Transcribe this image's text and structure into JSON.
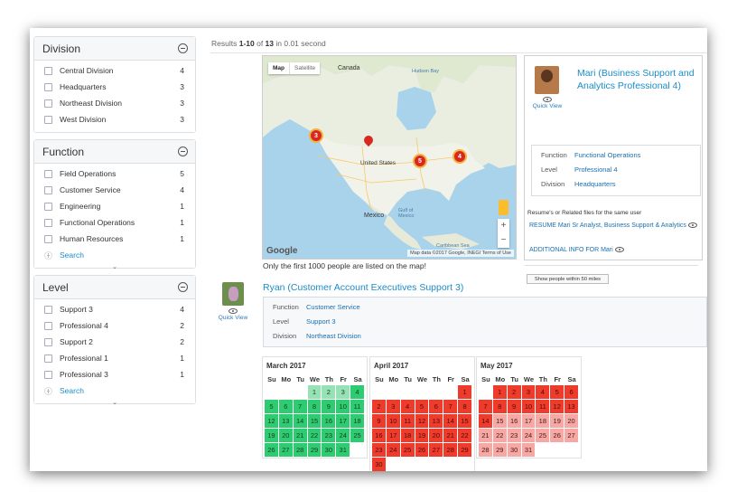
{
  "facets": {
    "division": {
      "title": "Division",
      "items": [
        {
          "label": "Central Division",
          "count": "4"
        },
        {
          "label": "Headquarters",
          "count": "3"
        },
        {
          "label": "Northeast Division",
          "count": "3"
        },
        {
          "label": "West Division",
          "count": "3"
        }
      ]
    },
    "function": {
      "title": "Function",
      "items": [
        {
          "label": "Field Operations",
          "count": "5"
        },
        {
          "label": "Customer Service",
          "count": "4"
        },
        {
          "label": "Engineering",
          "count": "1"
        },
        {
          "label": "Functional Operations",
          "count": "1"
        },
        {
          "label": "Human Resources",
          "count": "1"
        }
      ],
      "search_label": "Search"
    },
    "level": {
      "title": "Level",
      "items": [
        {
          "label": "Support 3",
          "count": "4"
        },
        {
          "label": "Professional 4",
          "count": "2"
        },
        {
          "label": "Support 2",
          "count": "2"
        },
        {
          "label": "Professional 1",
          "count": "1"
        },
        {
          "label": "Professional 3",
          "count": "1"
        }
      ],
      "search_label": "Search"
    }
  },
  "results": {
    "prefix": "Results ",
    "range": "1-10",
    "of": " of ",
    "total": "13",
    "suffix": " in 0.01 second"
  },
  "map": {
    "tab_map": "Map",
    "tab_satellite": "Satellite",
    "labels": {
      "canada": "Canada",
      "hudson_bay": "Hudson Bay",
      "united_states": "United States",
      "mexico": "Mexico",
      "gulf": "Gulf of Mexico",
      "caribbean": "Caribbean Sea"
    },
    "clusters": [
      "3",
      "5",
      "4"
    ],
    "zoom_in": "+",
    "zoom_out": "−",
    "google": "Google",
    "attribution": "Map data ©2017 Google, INEGI   Terms of Use",
    "note": "Only the first 1000 people are listed on the map!"
  },
  "popup": {
    "name": "Mari (Business Support and Analytics Professional 4)",
    "quick_view": "Quick View",
    "details": [
      {
        "k": "Function",
        "v": "Functional Operations"
      },
      {
        "k": "Level",
        "v": "Professional 4"
      },
      {
        "k": "Division",
        "v": "Headquarters"
      }
    ],
    "resume_heading": "Resume's or Related files for the same user",
    "resume_link": "RESUME Mari Sr Analyst, Business Support & Analytics",
    "info_link": "ADDITIONAL INFO FOR Mari",
    "nearby_button": "Show people within 50 miles"
  },
  "ryan": {
    "name": "Ryan (Customer Account Executives Support 3)",
    "quick_view": "Quick View",
    "details": [
      {
        "k": "Function",
        "v": "Customer Service"
      },
      {
        "k": "Level",
        "v": "Support 3"
      },
      {
        "k": "Division",
        "v": "Northeast Division"
      }
    ]
  },
  "calendars": [
    {
      "title": "March 2017",
      "headers": [
        "Su",
        "Mo",
        "Tu",
        "We",
        "Th",
        "Fr",
        "Sa"
      ],
      "lead": 3,
      "days": 31,
      "status": "green"
    },
    {
      "title": "April 2017",
      "headers": [
        "Su",
        "Mo",
        "Tu",
        "We",
        "Th",
        "Fr",
        "Sa"
      ],
      "lead": 6,
      "days": 30,
      "status": "red"
    },
    {
      "title": "May 2017",
      "headers": [
        "Su",
        "Mo",
        "Tu",
        "We",
        "Th",
        "Fr",
        "Sa"
      ],
      "lead": 1,
      "days": 31,
      "status": "may"
    }
  ],
  "colors": {
    "available": "#2ecc71",
    "booked": "#ef3b2c",
    "partial": "#f6a8a4",
    "link": "#1a8dc8"
  }
}
